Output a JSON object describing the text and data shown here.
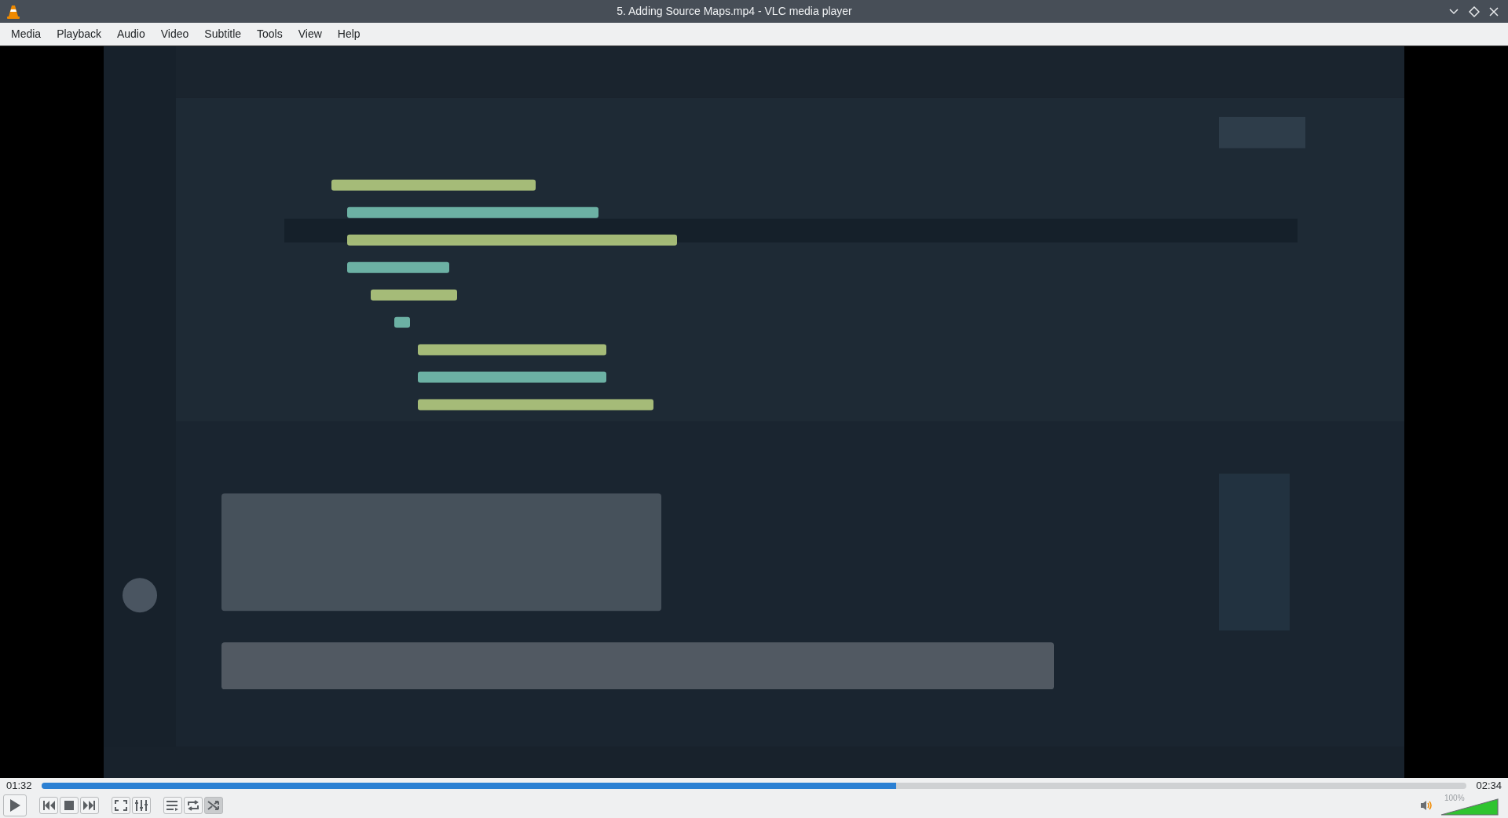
{
  "window": {
    "title": "5. Adding Source Maps.mp4 - VLC media player"
  },
  "menu": [
    "Media",
    "Playback",
    "Audio",
    "Video",
    "Subtitle",
    "Tools",
    "View",
    "Help"
  ],
  "video": {
    "kind": "picture"
  },
  "seek": {
    "elapsed": "01:32",
    "total": "02:34",
    "level": 0.6
  },
  "controls": [
    {
      "kind": "play"
    },
    {
      "kind": "prev"
    },
    {
      "kind": "stop"
    },
    {
      "kind": "next"
    },
    {
      "kind": "fullscreen"
    },
    {
      "kind": "extended"
    },
    {
      "kind": "playlist"
    },
    {
      "kind": "loop",
      "on": false
    },
    {
      "kind": "random",
      "on": true
    }
  ],
  "volume": {
    "reading": "100%",
    "level": 1.0,
    "muted": false
  }
}
